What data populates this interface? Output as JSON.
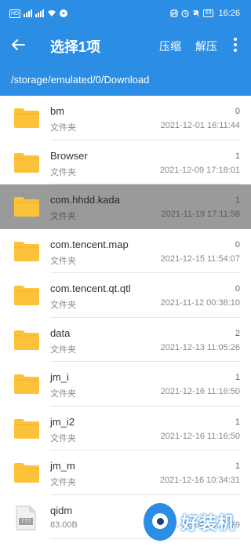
{
  "status": {
    "hd_label": "HD",
    "battery": "69",
    "time": "16:26"
  },
  "appbar": {
    "title": "选择1项",
    "compress_label": "压缩",
    "extract_label": "解压"
  },
  "path": "/storage/emulated/0/Download",
  "files": [
    {
      "name": "bm",
      "sub": "文件夹",
      "count": "0",
      "date": "2021-12-01 16:11:44",
      "type": "folder",
      "selected": false
    },
    {
      "name": "Browser",
      "sub": "文件夹",
      "count": "1",
      "date": "2021-12-09 17:18:01",
      "type": "folder",
      "selected": false
    },
    {
      "name": "com.hhdd.kada",
      "sub": "文件夹",
      "count": "1",
      "date": "2021-11-19 17:11:58",
      "type": "folder",
      "selected": true
    },
    {
      "name": "com.tencent.map",
      "sub": "文件夹",
      "count": "0",
      "date": "2021-12-15 11:54:07",
      "type": "folder",
      "selected": false
    },
    {
      "name": "com.tencent.qt.qtl",
      "sub": "文件夹",
      "count": "0",
      "date": "2021-11-12 00:38:10",
      "type": "folder",
      "selected": false
    },
    {
      "name": "data",
      "sub": "文件夹",
      "count": "2",
      "date": "2021-12-13 11:05:26",
      "type": "folder",
      "selected": false
    },
    {
      "name": "jm_i",
      "sub": "文件夹",
      "count": "1",
      "date": "2021-12-16 11:16:50",
      "type": "folder",
      "selected": false
    },
    {
      "name": "jm_i2",
      "sub": "文件夹",
      "count": "1",
      "date": "2021-12-16 11:16:50",
      "type": "folder",
      "selected": false
    },
    {
      "name": "jm_m",
      "sub": "文件夹",
      "count": "1",
      "date": "2021-12-16 10:34:31",
      "type": "folder",
      "selected": false
    },
    {
      "name": "qidm",
      "sub": "83.00B",
      "count": "",
      "date": "2021-12-06 16:16:39",
      "type": "file",
      "file_badge": "???",
      "selected": false
    }
  ],
  "watermark": {
    "text": "好装机"
  },
  "colors": {
    "accent": "#2b8de3",
    "folder": "#fcc33a",
    "selected_row": "#9a9a9a"
  }
}
